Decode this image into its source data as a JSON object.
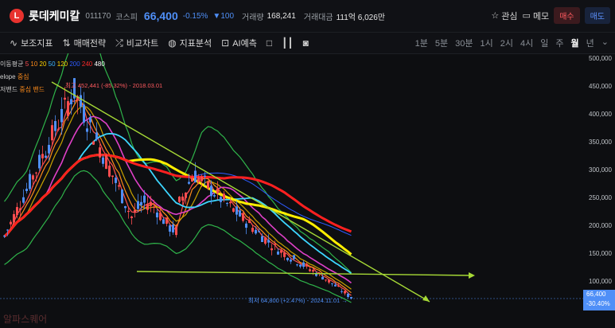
{
  "header": {
    "logo_text": "L",
    "name": "롯데케미칼",
    "code": "011170",
    "market": "코스피",
    "price": "66,400",
    "change_pct": "-0.15%",
    "change_abs": "▼100",
    "volume_label": "거래량",
    "volume": "168,241",
    "amount_label": "거래대금",
    "amount": "111억 6,026만",
    "watch_label": "관심",
    "memo_label": "메모",
    "buy_label": "매수",
    "sell_label": "매도"
  },
  "toolbar": {
    "items": [
      "보조지표",
      "매매전략",
      "비교차트",
      "지표분석",
      "AI예측"
    ],
    "periods": [
      "1분",
      "5분",
      "30분",
      "1시",
      "2시",
      "4시",
      "일",
      "주",
      "월",
      "년"
    ],
    "active_period": "월"
  },
  "legend": {
    "ma_label": "이동평균",
    "ma_periods": [
      "5",
      "10",
      "20",
      "50",
      "120",
      "200",
      "240",
      "480"
    ],
    "ma_colors": [
      "#ff4d4f",
      "#ff8c1a",
      "#ffd400",
      "#3db3ff",
      "#ffd400",
      "#2e5bff",
      "#ff2a2a",
      "#ffffff"
    ],
    "envelope_label": "elope",
    "envelope_value": "중심",
    "band_label": "저밴드",
    "band_value": "중심 밴드"
  },
  "chart_annotations": {
    "high_label": "최고 452,441 (-85.32%) - 2018.03.01",
    "low_label": "최저 64,800 (+2.47%) - 2024.11.01 →"
  },
  "yaxis": {
    "labels": [
      "500,000",
      "450,000",
      "400,000",
      "350,000",
      "300,000",
      "250,000",
      "200,000",
      "150,000",
      "100,000"
    ]
  },
  "price_tag": {
    "price": "66,400",
    "pct": "-30.40%"
  },
  "watermark": "알파스퀘어",
  "colors": {
    "up": "#ff4d4f",
    "down": "#4f8ff7",
    "trendline": "#a6d936"
  }
}
